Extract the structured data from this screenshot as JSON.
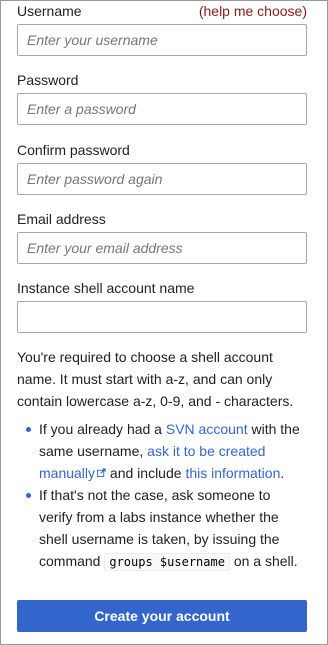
{
  "username": {
    "label": "Username",
    "help": "(help me choose)",
    "placeholder": "Enter your username"
  },
  "password": {
    "label": "Password",
    "placeholder": "Enter a password"
  },
  "confirm": {
    "label": "Confirm password",
    "placeholder": "Enter password again"
  },
  "email": {
    "label": "Email address",
    "placeholder": "Enter your email address"
  },
  "shell": {
    "label": "Instance shell account name",
    "placeholder": ""
  },
  "info": {
    "intro": "You're required to choose a shell account name. It must start with a-z, and can only contain lowercase a-z, 0-9, and - characters.",
    "b1_t1": "If you already had a ",
    "b1_link1": "SVN account",
    "b1_t2": " with the same username, ",
    "b1_link2": "ask it to be created manually",
    "b1_t3": " and include ",
    "b1_link3": "this information",
    "b1_t4": ".",
    "b2_t1": "If that's not the case, ask someone to verify from a labs instance whether the shell username is taken, by issuing the command ",
    "b2_code": "groups $username",
    "b2_t2": " on a shell."
  },
  "submit": {
    "label": "Create your account"
  },
  "colors": {
    "accent": "#3366cc",
    "help_link": "#8b1a1a",
    "border": "#a2a9b1"
  },
  "icons": {
    "external": "external-link-icon"
  }
}
